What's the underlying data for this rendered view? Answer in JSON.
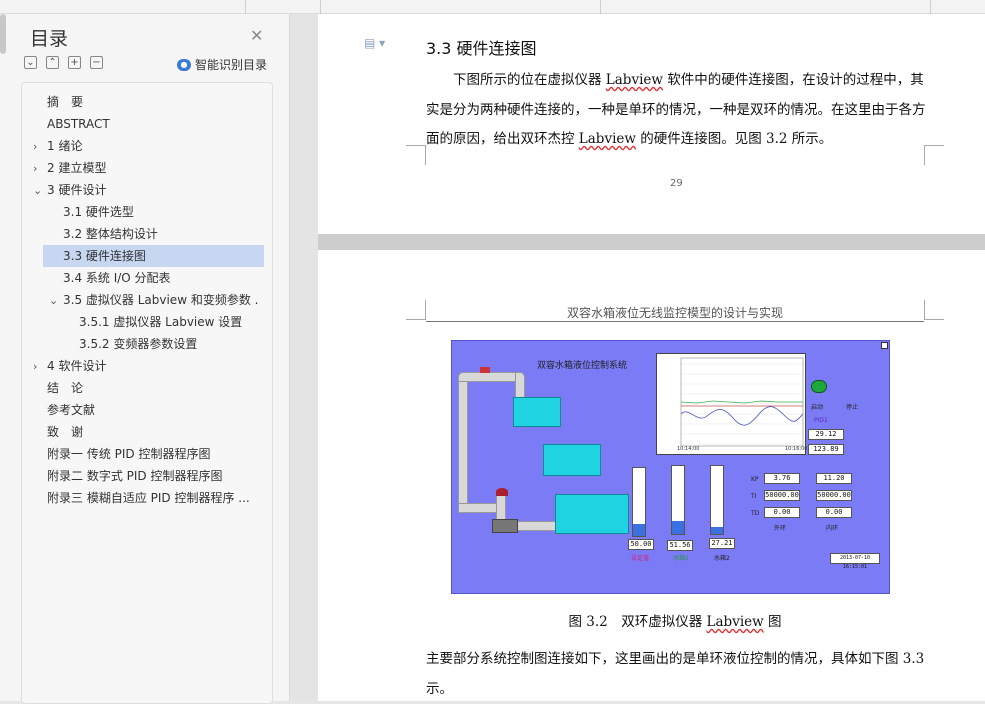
{
  "sidebar": {
    "title": "目录",
    "smart_toc_label": "智能识别目录",
    "items": [
      {
        "label": "摘　要",
        "level": 0,
        "chevron": ""
      },
      {
        "label": "ABSTRACT",
        "level": 0,
        "chevron": ""
      },
      {
        "label": "1 绪论",
        "level": 0,
        "chevron": "›"
      },
      {
        "label": "2 建立模型",
        "level": 0,
        "chevron": "›"
      },
      {
        "label": "3 硬件设计",
        "level": 0,
        "chevron": "⌄"
      },
      {
        "label": "3.1 硬件选型",
        "level": 1,
        "chevron": ""
      },
      {
        "label": "3.2 整体结构设计",
        "level": 1,
        "chevron": ""
      },
      {
        "label": "3.3 硬件连接图",
        "level": 1,
        "chevron": "",
        "active": true
      },
      {
        "label": "3.4 系统 I/O 分配表",
        "level": 1,
        "chevron": ""
      },
      {
        "label": "3.5 虚拟仪器 Labview 和变频参数 ...",
        "level": 1,
        "chevron": "⌄"
      },
      {
        "label": "3.5.1 虚拟仪器 Labview 设置",
        "level": 2,
        "chevron": ""
      },
      {
        "label": "3.5.2 变频器参数设置",
        "level": 2,
        "chevron": ""
      },
      {
        "label": "4 软件设计",
        "level": 0,
        "chevron": "›"
      },
      {
        "label": "结　论",
        "level": 0,
        "chevron": ""
      },
      {
        "label": "参考文献",
        "level": 0,
        "chevron": ""
      },
      {
        "label": "致　谢",
        "level": 0,
        "chevron": ""
      },
      {
        "label": "附录一 传统 PID 控制器程序图",
        "level": 0,
        "chevron": ""
      },
      {
        "label": "附录二 数字式 PID 控制器程序图",
        "level": 0,
        "chevron": ""
      },
      {
        "label": "附录三 模糊自适应 PID 控制器程序 ...",
        "level": 0,
        "chevron": ""
      }
    ]
  },
  "page1": {
    "heading": "3.3 硬件连接图",
    "para_before": "下图所示的位在虚拟仪器 ",
    "labview1": "Labview",
    "para_mid": " 软件中的硬件连接图，在设计的过程中，其实是分为两种硬件连接的，一种是单环的情况，一种是双环的情况。在这里由于各方面的原因，给出双环杰控 ",
    "labview2": "Labview",
    "para_after": " 的硬件连接图。见图 3.2 所示。",
    "page_number": "29"
  },
  "page2": {
    "running_header": "双容水箱液位无线监控模型的设计与实现",
    "figure": {
      "title": "双容水箱液位控制系统",
      "start_label": "启动",
      "stop_label": "停止",
      "pid_label": "PID1",
      "out1": "29.12",
      "out2": "123.89",
      "gauge_vals": [
        "50.00",
        "51.56",
        "27.21"
      ],
      "gauge_names": [
        "设定值",
        "水箱1",
        "水箱2"
      ],
      "kp_label": "KP",
      "ti_label": "TI",
      "td_label": "TD",
      "outer": {
        "kp": "3.76",
        "ti": "50000.00",
        "td": "0.00",
        "name": "外环"
      },
      "inner": {
        "kp": "11.20",
        "ti": "50000.00",
        "td": "0.00",
        "name": "内环"
      },
      "graph_t0": "10:14:00",
      "graph_t1": "10:16:00",
      "timestamp": "2013-07-10 16:15:01",
      "levels": [
        0.18,
        0.19,
        0.11
      ]
    },
    "caption_prefix": "图 3.2　双环虚拟仪器 ",
    "caption_lab": "Labview",
    "caption_suffix": " 图",
    "para2": "主要部分系统控制图连接如下，这里画出的是单环液位控制的情况，具体如下图 3.3 示。"
  }
}
